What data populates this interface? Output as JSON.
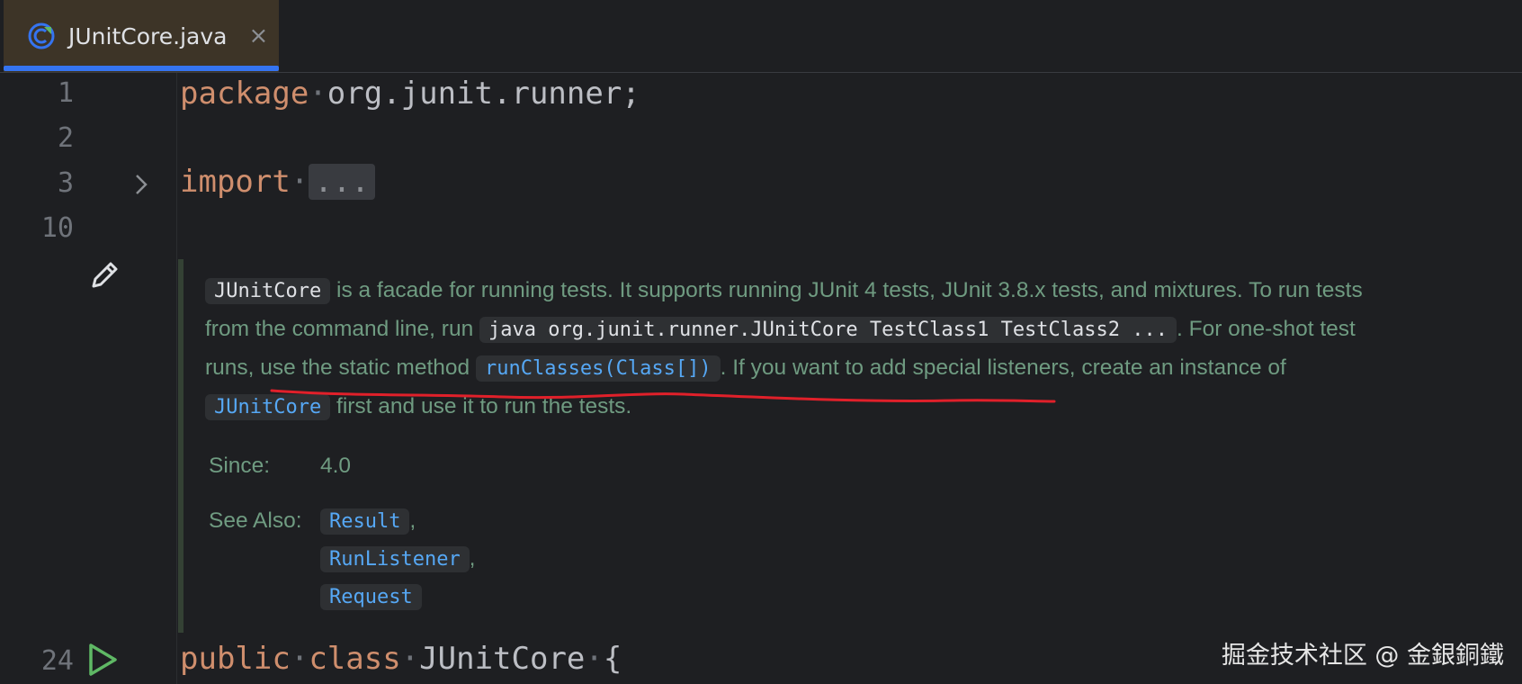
{
  "tab": {
    "title": "JUnitCore.java",
    "close_glyph": "×",
    "icon": "class-icon"
  },
  "gutter": {
    "line_numbers": [
      "1",
      "2",
      "3",
      "10",
      "24"
    ]
  },
  "code": {
    "line1_keyword": "package",
    "line1_rest": "org.junit.runner;",
    "line3_keyword": "import",
    "line3_fold": "...",
    "line24_kw1": "public",
    "line24_kw2": "class",
    "line24_name": "JUnitCore",
    "line24_brace": "{"
  },
  "doc": {
    "p1_chip": "JUnitCore",
    "p1_text": " is a facade for running tests. It supports running JUnit 4 tests, JUnit 3.8.x tests, and mixtures. To run tests from the command line, run ",
    "p2_chip": "java org.junit.runner.JUnitCore TestClass1 TestClass2 ...",
    "p3_text": ". For one-shot test runs, use the static method ",
    "p3_chip": "runClasses(Class[])",
    "p4_text": ". If you want to add special listeners, create an instance of ",
    "p4_chip": "JUnitCore",
    "p5_text": " first and use it to run the tests.",
    "since_label": "Since:",
    "since_value": "4.0",
    "see_also_label": "See Also:",
    "see_also": [
      "Result",
      "RunListener",
      "Request"
    ],
    "comma": ","
  },
  "watermark": "掘金技术社区 @ 金銀銅鐵",
  "colors": {
    "keyword": "#cf8e6d",
    "link": "#56a8f5",
    "doc_text": "#6f9b81",
    "annotation_red": "#e0202a"
  }
}
